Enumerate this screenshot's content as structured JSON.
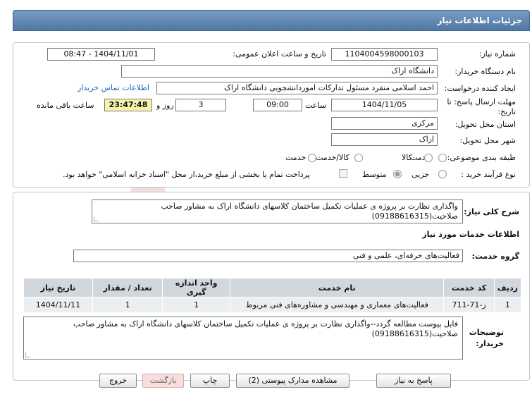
{
  "window": {
    "title": "جزئیات اطلاعات نیاز"
  },
  "form": {
    "need_number_label": "شماره نیاز:",
    "need_number": "1104004598000103",
    "announce_label": "تاریخ و ساعت اعلان عمومی:",
    "announce_value": "1404/11/01 - 08:47",
    "buyer_label": "نام دستگاه خریدار:",
    "buyer_value": "دانشگاه اراک",
    "creator_label": "ایجاد کننده درخواست:",
    "creator_value": "احمد  اسلامی منفرد مسئول تدارکات اموردانشجویی دانشگاه اراک",
    "contact_link": "اطلاعات تماس خریدار",
    "deadline_label_1": "مهلت ارسال پاسخ: تا",
    "deadline_label_2": "تاریخ:",
    "deadline_date": "1404/11/05",
    "hour_label": "ساعت",
    "deadline_hour": "09:00",
    "days_value": "3",
    "days_label": "روز و",
    "remaining_time": "23:47:48",
    "remaining_label": "ساعت باقی مانده",
    "province_label": "استان محل تحویل:",
    "province_value": "مرکزی",
    "city_label": "شهر محل تحویل:",
    "city_value": "اراک",
    "category_label": "طبقه بندی موضوعی:",
    "category_options": [
      "کالا",
      "کالا/خدمت"
    ],
    "category_selected": "خدمت",
    "process_label": "نوع فرآیند خرید :",
    "process_options": [
      "جزیی",
      "متوسط"
    ],
    "process_selected": "متوسط",
    "payment_note": "پرداخت تمام یا بخشی از مبلغ خرید،از محل \"اسناد خزانه اسلامی\" خواهد بود."
  },
  "summary": {
    "label": "شرح کلی نیاز:",
    "text": "واگذاری نظارت بر پروژه ی عملیات تکمیل ساختمان کلاسهای دانشگاه اراک به مشاور صاحب صلاحیت(09188616315)"
  },
  "services": {
    "section_title": "اطلاعات خدمات مورد نیاز",
    "group_label": "گروه خدمت:",
    "group_value": "فعالیت‌های حرفه‌ای، علمی و فنی",
    "columns": [
      "ردیف",
      "کد خدمت",
      "نام خدمت",
      "واحد اندازه گیری",
      "تعداد / مقدار",
      "تاریخ نیاز"
    ],
    "rows": [
      [
        "1",
        "ز-71-711",
        "فعالیت‌های معماری و مهندسی و مشاوره‌های فنی مربوط",
        "1",
        "1",
        "1404/11/11"
      ]
    ]
  },
  "buyer_notes": {
    "label_1": "توضیحات",
    "label_2": "خریدار:",
    "text": "فایل پیوست مطالعه گردد--واگذاری نظارت بر پروژه ی عملیات تکمیل ساختمان کلاسهای دانشگاه اراک به مشاور صاحب صلاحیت(09188616315)"
  },
  "buttons": {
    "reply": "پاسخ به نیاز",
    "view_docs": "مشاهده مدارک پیوستی (2)",
    "print": "چاپ",
    "back": "بازگشت",
    "exit": "خروج"
  },
  "colors": {
    "header": "#5a7fab",
    "timer_bg": "#f7f3ad",
    "link": "#1565c0",
    "table_header": "#d2d7dd",
    "table_row": "#eceff2"
  }
}
